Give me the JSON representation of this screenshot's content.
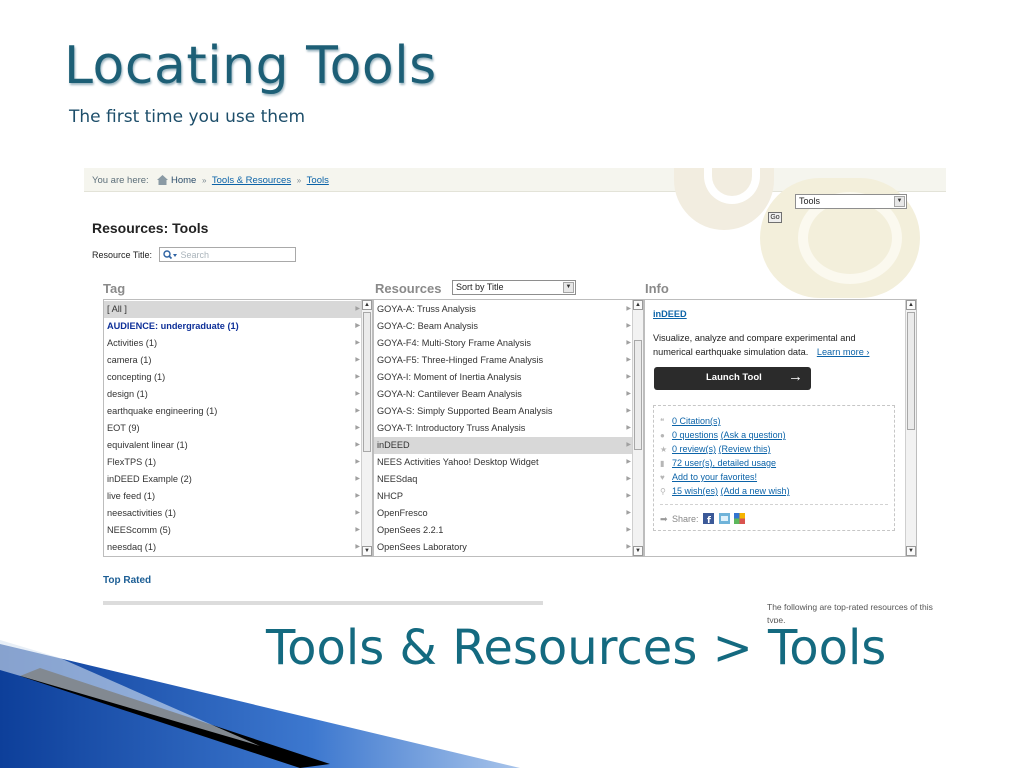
{
  "slide": {
    "title": "Locating Tools",
    "subtitle": "The first time you use them",
    "caption": "Tools & Resources > Tools"
  },
  "breadcrumb": {
    "prefix": "You are here:",
    "items": [
      "Home",
      "Tools & Resources",
      "Tools"
    ],
    "separator": "»"
  },
  "type_select": {
    "value": "Tools"
  },
  "go_label": "Go",
  "page_heading": "Resources: Tools",
  "resource_title": {
    "label": "Resource Title:",
    "placeholder": "Search"
  },
  "columns": {
    "tag": "Tag",
    "resources": "Resources",
    "info": "Info"
  },
  "sort_select": {
    "value": "Sort by Title"
  },
  "tags": [
    "[ All ]",
    "AUDIENCE: undergraduate (1)",
    "Activities (1)",
    "camera (1)",
    "concepting (1)",
    "design (1)",
    "earthquake engineering (1)",
    "EOT (9)",
    "equivalent linear (1)",
    "FlexTPS (1)",
    "inDEED Example (2)",
    "live feed (1)",
    "neesactivities (1)",
    "NEEScomm (5)",
    "neesdaq (1)"
  ],
  "selected_tag_index": 0,
  "highlight_tag_index": 1,
  "resources": [
    "GOYA-A: Truss Analysis",
    "GOYA-C: Beam Analysis",
    "GOYA-F4: Multi-Story Frame Analysis",
    "GOYA-F5: Three-Hinged Frame Analysis",
    "GOYA-I: Moment of Inertia Analysis",
    "GOYA-N: Cantilever Beam Analysis",
    "GOYA-S: Simply Supported Beam Analysis",
    "GOYA-T: Introductory Truss Analysis",
    "inDEED",
    "NEES Activities Yahoo! Desktop Widget",
    "NEESdaq",
    "NHCP",
    "OpenFresco",
    "OpenSees 2.2.1",
    "OpenSees Laboratory"
  ],
  "selected_resource_index": 8,
  "info": {
    "title": "inDEED",
    "description": "Visualize, analyze and compare experimental and numerical earthquake simulation data.",
    "learn_more": "Learn more ›",
    "launch_label": "Launch Tool",
    "launch_arrow": "→",
    "citations": "0 Citation(s)",
    "questions": "0 questions",
    "ask_question": "(Ask a question)",
    "reviews": "0 review(s)",
    "review_this": "(Review this)",
    "usage": "72 user(s), detailed usage",
    "favorites": "Add to your favorites!",
    "wishes": "15 wish(es)",
    "add_wish": "(Add a new wish)",
    "share_label": "Share:"
  },
  "top_rated": {
    "heading": "Top Rated",
    "description": "The following are top-rated resources of this type."
  },
  "colors": {
    "accent": "#0b63a8",
    "title": "#1d5f76",
    "caption": "#146a80"
  }
}
